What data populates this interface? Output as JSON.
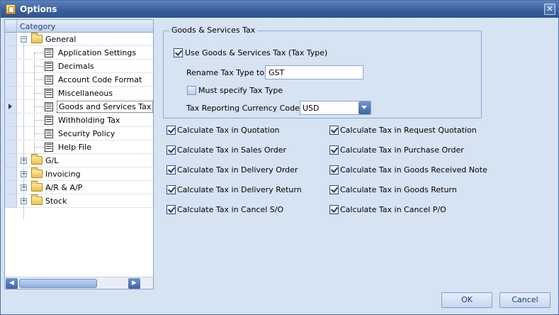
{
  "window": {
    "title": "Options",
    "close_glyph": "✕"
  },
  "tree": {
    "header": "Category",
    "items": [
      {
        "label": "General",
        "kind": "folder",
        "expander": "−"
      },
      {
        "label": "Application Settings",
        "kind": "doc"
      },
      {
        "label": "Decimals",
        "kind": "doc"
      },
      {
        "label": "Account Code Format",
        "kind": "doc"
      },
      {
        "label": "Miscellaneous",
        "kind": "doc"
      },
      {
        "label": "Goods and Services Tax",
        "kind": "doc",
        "selected": true
      },
      {
        "label": "Withholding Tax",
        "kind": "doc"
      },
      {
        "label": "Security Policy",
        "kind": "doc"
      },
      {
        "label": "Help File",
        "kind": "doc"
      },
      {
        "label": "G/L",
        "kind": "folder",
        "expander": "+"
      },
      {
        "label": "Invoicing",
        "kind": "folder",
        "expander": "+"
      },
      {
        "label": "A/R & A/P",
        "kind": "folder",
        "expander": "+"
      },
      {
        "label": "Stock",
        "kind": "folder",
        "expander": "+"
      }
    ],
    "scroll_left": "◀",
    "scroll_right": "▶"
  },
  "gst": {
    "group_title": "Goods & Services Tax",
    "use_gst": {
      "label": "Use Goods & Services Tax (Tax Type)",
      "checked": true
    },
    "rename_label": "Rename Tax Type to",
    "rename_value": "GST",
    "must_specify": {
      "label": "Must specify Tax Type",
      "checked": false
    },
    "currency_label": "Tax Reporting Currency Code:",
    "currency_value": "USD"
  },
  "options_left": [
    {
      "label": "Calculate Tax in Quotation",
      "checked": true
    },
    {
      "label": "Calculate Tax in Sales Order",
      "checked": true
    },
    {
      "label": "Calculate Tax in Delivery Order",
      "checked": true
    },
    {
      "label": "Calculate Tax in Delivery Return",
      "checked": true
    },
    {
      "label": "Calculate Tax in Cancel S/O",
      "checked": true
    }
  ],
  "options_right": [
    {
      "label": "Calculate Tax in Request Quotation",
      "checked": true
    },
    {
      "label": "Calculate Tax in Purchase Order",
      "checked": true
    },
    {
      "label": "Calculate Tax in Goods Received Note",
      "checked": true
    },
    {
      "label": "Calculate Tax in Goods Return",
      "checked": true
    },
    {
      "label": "Calculate Tax in Cancel P/O",
      "checked": true
    }
  ],
  "buttons": {
    "ok": "OK",
    "cancel": "Cancel"
  }
}
